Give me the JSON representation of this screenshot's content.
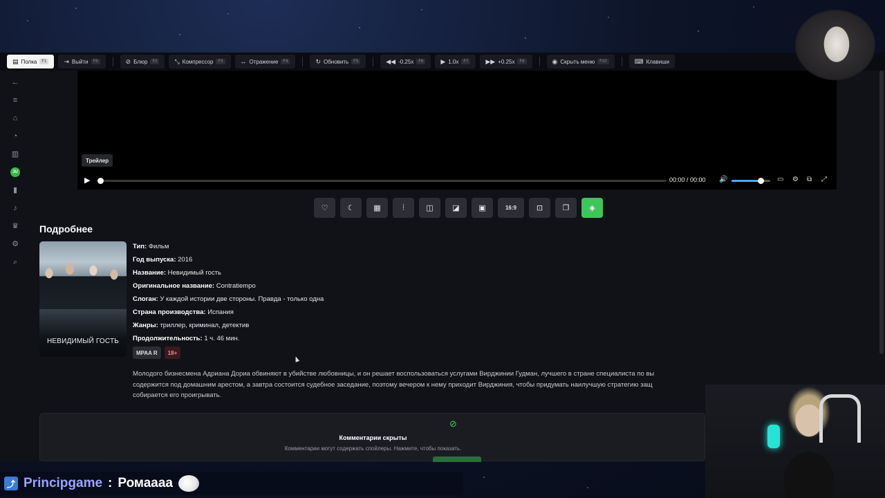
{
  "toolbar": {
    "shelf": {
      "label": "Полка",
      "key": "F1"
    },
    "exit": {
      "label": "Выйти",
      "key": "F6"
    },
    "blur": {
      "label": "Блюр",
      "key": "F2"
    },
    "compressor": {
      "label": "Компрессор",
      "key": "F3"
    },
    "mirror": {
      "label": "Отражение",
      "key": "F4"
    },
    "refresh": {
      "label": "Обновить",
      "key": "F5"
    },
    "speed_down": {
      "label": "-0.25x",
      "key": "F6"
    },
    "speed": {
      "label": "1.0x",
      "key": "F7"
    },
    "speed_up": {
      "label": "+0.25x",
      "key": "F8"
    },
    "hide_menu": {
      "label": "Скрыть меню",
      "key": "F10"
    },
    "keys": {
      "label": "Клавиши"
    }
  },
  "player": {
    "trailer_label": "Трейлер",
    "time": "00:00 / 00:00",
    "progress": 0,
    "volume": 0.75
  },
  "action_bar": {
    "aspect_label": "16:9"
  },
  "details": {
    "section_title": "Подробнее",
    "poster_title": "НЕВИДИМЫЙ ГОСТЬ",
    "rows": [
      {
        "label": "Тип:",
        "value": "Фильм"
      },
      {
        "label": "Год выпуска:",
        "value": "2016"
      },
      {
        "label": "Название:",
        "value": "Невидимый гость"
      },
      {
        "label": "Оригинальное название:",
        "value": "Contratiempo"
      },
      {
        "label": "Слоган:",
        "value": "У каждой истории две стороны. Правда - только одна"
      },
      {
        "label": "Страна производства:",
        "value": "Испания"
      },
      {
        "label": "Жанры:",
        "value": "триллер, криминал, детектив"
      },
      {
        "label": "Продолжительность:",
        "value": "1 ч. 46 мин."
      }
    ],
    "badges": {
      "mpaa": "MPAA R",
      "age": "18+"
    },
    "description": [
      "Молодого бизнесмена Адриана Дориа обвиняют в убийстве любовницы, и он решает воспользоваться услугами Вирджинии Гудман, лучшего в стране специалиста по вы",
      "содержится под домашним арестом, а завтра состоится судебное заседание, поэтому вечером к нему приходит Вирджиния, чтобы придумать наилучшую стратегию защ",
      "собирается его проигрывать."
    ]
  },
  "comments": {
    "title": "Комментарии скрыты",
    "subtitle": "Комментарии могут содержать спойлеры. Нажмите, чтобы показать."
  },
  "chat": {
    "user": "Principgame",
    "separator": ":",
    "message": "Ромаааа"
  },
  "colors": {
    "accent_green": "#3fc55a",
    "volume_blue": "#4aa8ff",
    "chat_user": "#9aa4ff"
  }
}
